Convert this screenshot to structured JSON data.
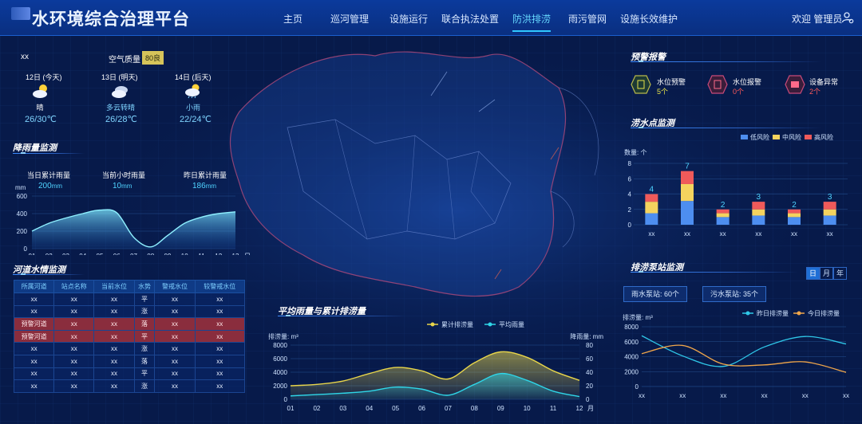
{
  "header": {
    "title": "水环境综合治理平台",
    "nav": [
      "主页",
      "巡河管理",
      "设施运行",
      "联合执法处置",
      "防洪排涝",
      "雨污管网",
      "设施长效维护"
    ],
    "active_nav": "防洪排涝",
    "welcome": "欢迎 管理员"
  },
  "weather": {
    "location": "xx",
    "air_label": "空气质量",
    "air_value": "80良",
    "days": [
      {
        "date": "12日 (今天)",
        "desc": "晴",
        "temp": "26/30℃"
      },
      {
        "date": "13日 (明天)",
        "desc": "多云转晴",
        "temp": "26/28℃"
      },
      {
        "date": "14日 (后天)",
        "desc": "小雨",
        "temp": "22/24℃"
      }
    ]
  },
  "rainfall": {
    "title": "降雨量监测",
    "stats": [
      {
        "label": "当日累计雨量",
        "value": "200",
        "unit": "mm"
      },
      {
        "label": "当前小时雨量",
        "value": "10",
        "unit": "mm"
      },
      {
        "label": "昨日累计雨量",
        "value": "186",
        "unit": "mm"
      }
    ]
  },
  "river": {
    "title": "河道水情监测",
    "headers": [
      "所属河道",
      "站点名称",
      "当前水位",
      "水势",
      "警戒水位",
      "较警戒水位"
    ],
    "rows": [
      [
        "xx",
        "xx",
        "xx",
        "平",
        "xx",
        "xx"
      ],
      [
        "xx",
        "xx",
        "xx",
        "涨",
        "xx",
        "xx"
      ],
      [
        "预警河道",
        "xx",
        "xx",
        "落",
        "xx",
        "xx"
      ],
      [
        "预警河道",
        "xx",
        "xx",
        "平",
        "xx",
        "xx"
      ],
      [
        "xx",
        "xx",
        "xx",
        "涨",
        "xx",
        "xx"
      ],
      [
        "xx",
        "xx",
        "xx",
        "落",
        "xx",
        "xx"
      ],
      [
        "xx",
        "xx",
        "xx",
        "平",
        "xx",
        "xx"
      ],
      [
        "xx",
        "xx",
        "xx",
        "涨",
        "xx",
        "xx"
      ]
    ],
    "warn_rows": [
      2,
      3
    ]
  },
  "alarm": {
    "title": "预警报警",
    "items": [
      {
        "label": "水位预警",
        "value": "5个",
        "color": "#e8e34a"
      },
      {
        "label": "水位报警",
        "value": "0个",
        "color": "#ff5a5a"
      },
      {
        "label": "设备异常",
        "value": "2个",
        "color": "#ff5a5a"
      }
    ]
  },
  "waterlog": {
    "title": "涝水点监测"
  },
  "pump": {
    "title": "排涝泵站监测",
    "tabs": [
      "日",
      "月",
      "年"
    ],
    "active_tab": "日",
    "rain_pump": "雨水泵站: 60个",
    "sewage_pump": "污水泵站: 35个"
  },
  "drain": {
    "title": "平均雨量与累计排涝量"
  },
  "chart_data": [
    {
      "id": "rainfall",
      "type": "area",
      "ylabel": "mm",
      "xlabel": "日",
      "x": [
        "01",
        "02",
        "03",
        "04",
        "05",
        "06",
        "07",
        "08",
        "09",
        "10",
        "11",
        "12",
        "13"
      ],
      "ylim": [
        0,
        600
      ],
      "yticks": [
        0,
        200,
        400,
        600
      ],
      "series": [
        {
          "values": [
            200,
            290,
            350,
            400,
            440,
            410,
            130,
            20,
            150,
            290,
            360,
            400,
            420
          ]
        }
      ]
    },
    {
      "id": "waterlog",
      "type": "bar",
      "ylabel": "数量: 个",
      "categories": [
        "xx",
        "xx",
        "xx",
        "xx",
        "xx",
        "xx"
      ],
      "ylim": [
        0,
        8
      ],
      "yticks": [
        0,
        2,
        4,
        6,
        8
      ],
      "series": [
        {
          "name": "低风险",
          "color": "#4d8ef0",
          "values": [
            1.5,
            3.1,
            1.0,
            1.2,
            1.0,
            1.2
          ]
        },
        {
          "name": "中风险",
          "color": "#f4d35e",
          "values": [
            1.5,
            2.2,
            0.5,
            0.8,
            0.5,
            0.8
          ]
        },
        {
          "name": "高风险",
          "color": "#ef5a5a",
          "values": [
            1.0,
            1.7,
            0.5,
            1.0,
            0.5,
            1.0
          ]
        }
      ],
      "totals": [
        "4",
        "7",
        "2",
        "3",
        "2",
        "3"
      ]
    },
    {
      "id": "drain",
      "type": "area",
      "ylabel": "排涝量: m³",
      "ylabel_right": "降雨量: mm",
      "xlabel": "月",
      "x": [
        "01",
        "02",
        "03",
        "04",
        "05",
        "06",
        "07",
        "08",
        "09",
        "10",
        "11",
        "12"
      ],
      "ylim": [
        0,
        8000
      ],
      "yticks": [
        0,
        2000,
        4000,
        6000,
        8000
      ],
      "ylim_right": [
        0,
        80
      ],
      "yticks_right": [
        0,
        20,
        40,
        60,
        80
      ],
      "series": [
        {
          "name": "累计排涝量",
          "color": "#e8d54a",
          "axis": "left",
          "values": [
            2000,
            2200,
            2700,
            3800,
            4700,
            4200,
            3000,
            5400,
            7000,
            6200,
            4200,
            2800
          ]
        },
        {
          "name": "平均雨量",
          "color": "#2fd6e8",
          "axis": "right",
          "values": [
            5,
            7,
            9,
            12,
            18,
            15,
            6,
            22,
            38,
            28,
            12,
            4
          ]
        }
      ]
    },
    {
      "id": "pump",
      "type": "line",
      "ylabel": "排涝量: m³",
      "categories": [
        "xx",
        "xx",
        "xx",
        "xx",
        "xx",
        "xx"
      ],
      "ylim": [
        0,
        8000
      ],
      "yticks": [
        0,
        2000,
        4000,
        6000,
        8000
      ],
      "series": [
        {
          "name": "昨日排涝量",
          "color": "#2fc7e8",
          "values": [
            6800,
            4100,
            2700,
            5300,
            6700,
            5700
          ]
        },
        {
          "name": "今日排涝量",
          "color": "#f0a64a",
          "values": [
            4400,
            5500,
            3000,
            2900,
            3300,
            1900
          ]
        }
      ]
    }
  ]
}
